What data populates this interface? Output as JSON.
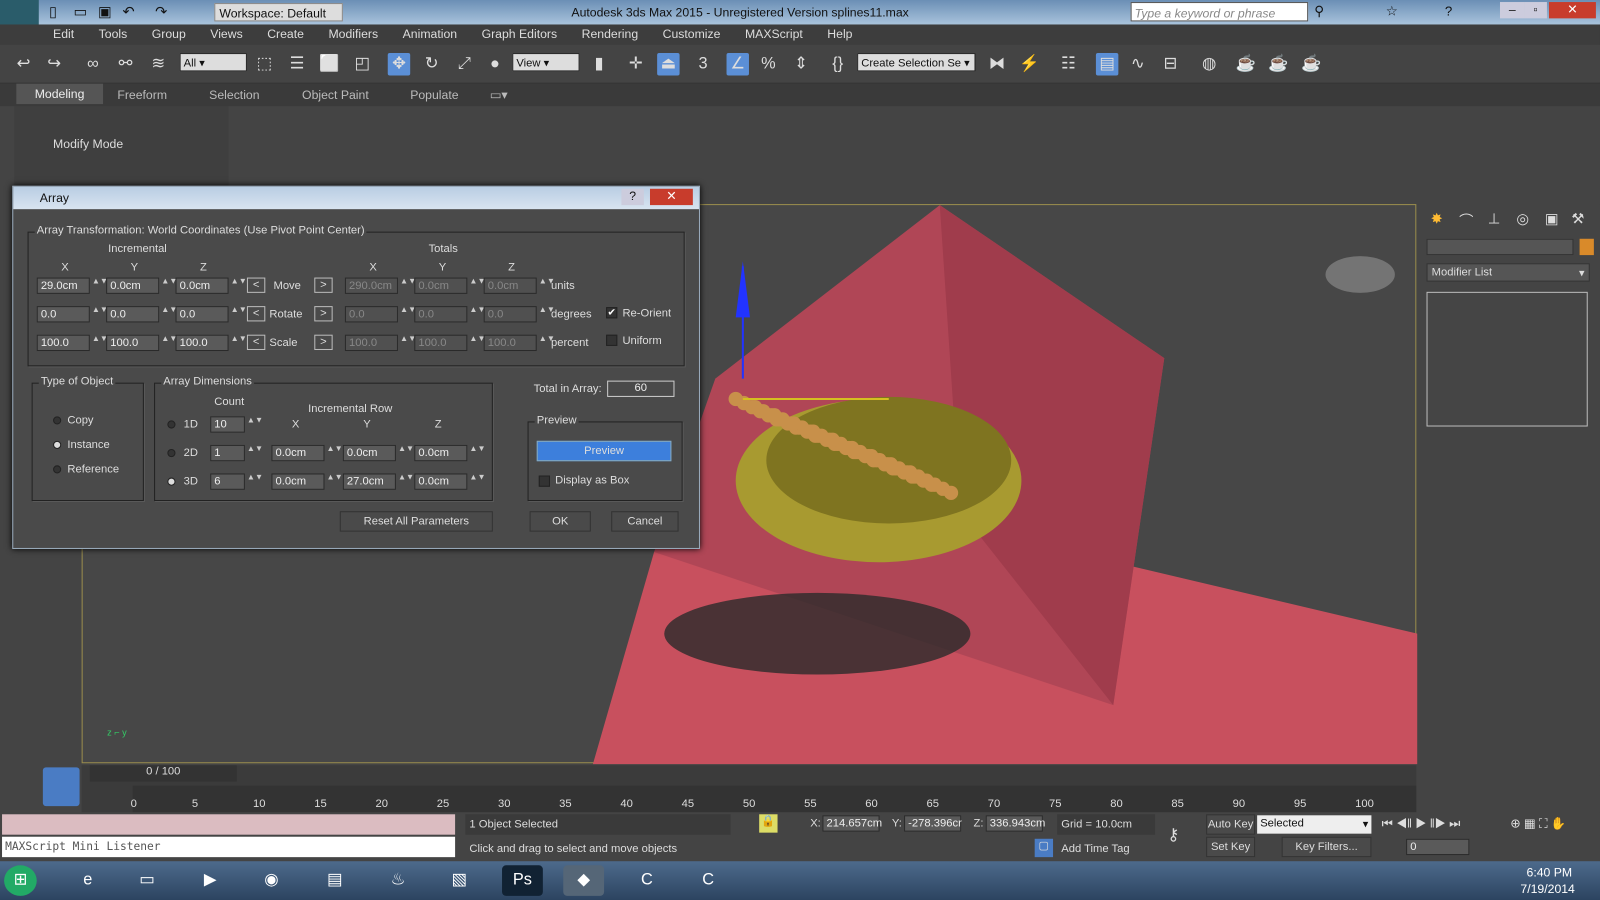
{
  "app": {
    "logo": "MAX",
    "workspace": "Workspace: Default",
    "title": "Autodesk 3ds Max  2015  - Unregistered Version   splines11.max",
    "search_placeholder": "Type a keyword or phrase"
  },
  "menu": [
    "Edit",
    "Tools",
    "Group",
    "Views",
    "Create",
    "Modifiers",
    "Animation",
    "Graph Editors",
    "Rendering",
    "Customize",
    "MAXScript",
    "Help"
  ],
  "toolbar": {
    "filter": "All",
    "ref_coord": "View",
    "selection_set": "Create Selection Se",
    "snap_3": "3",
    "snap_pct": "%"
  },
  "ribbon": {
    "tabs": [
      "Modeling",
      "Freeform",
      "Selection",
      "Object Paint",
      "Populate"
    ],
    "active": "Modeling",
    "mode_label": "Modify Mode"
  },
  "dialog": {
    "title": "Array",
    "help": "?",
    "close": "✕",
    "transform_group": "Array Transformation: World Coordinates (Use Pivot Point Center)",
    "incremental": "Incremental",
    "totals": "Totals",
    "axes": [
      "X",
      "Y",
      "Z"
    ],
    "rows": [
      {
        "label": "Move",
        "inc": [
          "29.0cm",
          "0.0cm",
          "0.0cm"
        ],
        "tot": [
          "290.0cm",
          "0.0cm",
          "0.0cm"
        ],
        "unit": "units"
      },
      {
        "label": "Rotate",
        "inc": [
          "0.0",
          "0.0",
          "0.0"
        ],
        "tot": [
          "0.0",
          "0.0",
          "0.0"
        ],
        "unit": "degrees"
      },
      {
        "label": "Scale",
        "inc": [
          "100.0",
          "100.0",
          "100.0"
        ],
        "tot": [
          "100.0",
          "100.0",
          "100.0"
        ],
        "unit": "percent"
      }
    ],
    "re_orient": {
      "label": "Re-Orient",
      "checked": true
    },
    "uniform": {
      "label": "Uniform",
      "checked": false
    },
    "type_group": "Type of Object",
    "types": [
      "Copy",
      "Instance",
      "Reference"
    ],
    "type_selected": "Instance",
    "dims_group": "Array Dimensions",
    "count_label": "Count",
    "inc_row_label": "Incremental Row",
    "dims": [
      {
        "label": "1D",
        "count": "10",
        "row": []
      },
      {
        "label": "2D",
        "count": "1",
        "row": [
          "0.0cm",
          "0.0cm",
          "0.0cm"
        ]
      },
      {
        "label": "3D",
        "count": "6",
        "row": [
          "0.0cm",
          "27.0cm",
          "0.0cm"
        ]
      }
    ],
    "dim_selected": "3D",
    "total_label": "Total in Array:",
    "total": "60",
    "preview_group": "Preview",
    "preview_btn": "Preview",
    "display_box": {
      "label": "Display as Box",
      "checked": false
    },
    "reset": "Reset All Parameters",
    "ok": "OK",
    "cancel": "Cancel"
  },
  "command_panel": {
    "modifier_list": "Modifier List"
  },
  "timeline": {
    "frame": "0 / 100",
    "ticks": [
      "0",
      "5",
      "10",
      "15",
      "20",
      "25",
      "30",
      "35",
      "40",
      "45",
      "50",
      "55",
      "60",
      "65",
      "70",
      "75",
      "80",
      "85",
      "90",
      "95",
      "100"
    ]
  },
  "status": {
    "listener": "MAXScript Mini Listener",
    "selected": "1 Object Selected",
    "prompt": "Click and drag to select and move objects",
    "x": "214.657cm",
    "y": "-278.396cr",
    "z": "336.943cm",
    "grid": "Grid = 10.0cm",
    "add_time_tag": "Add Time Tag",
    "auto_key": "Auto Key",
    "set_key": "Set Key",
    "key_mode": "Selected",
    "key_filters": "Key Filters...",
    "current_frame": "0"
  },
  "taskbar": {
    "time": "6:40 PM",
    "date": "7/19/2014"
  },
  "colors": {
    "accent": "#5b8fd6",
    "plane": "#c8505e",
    "bowl": "#a89a30",
    "spheres": "#c8904a"
  }
}
